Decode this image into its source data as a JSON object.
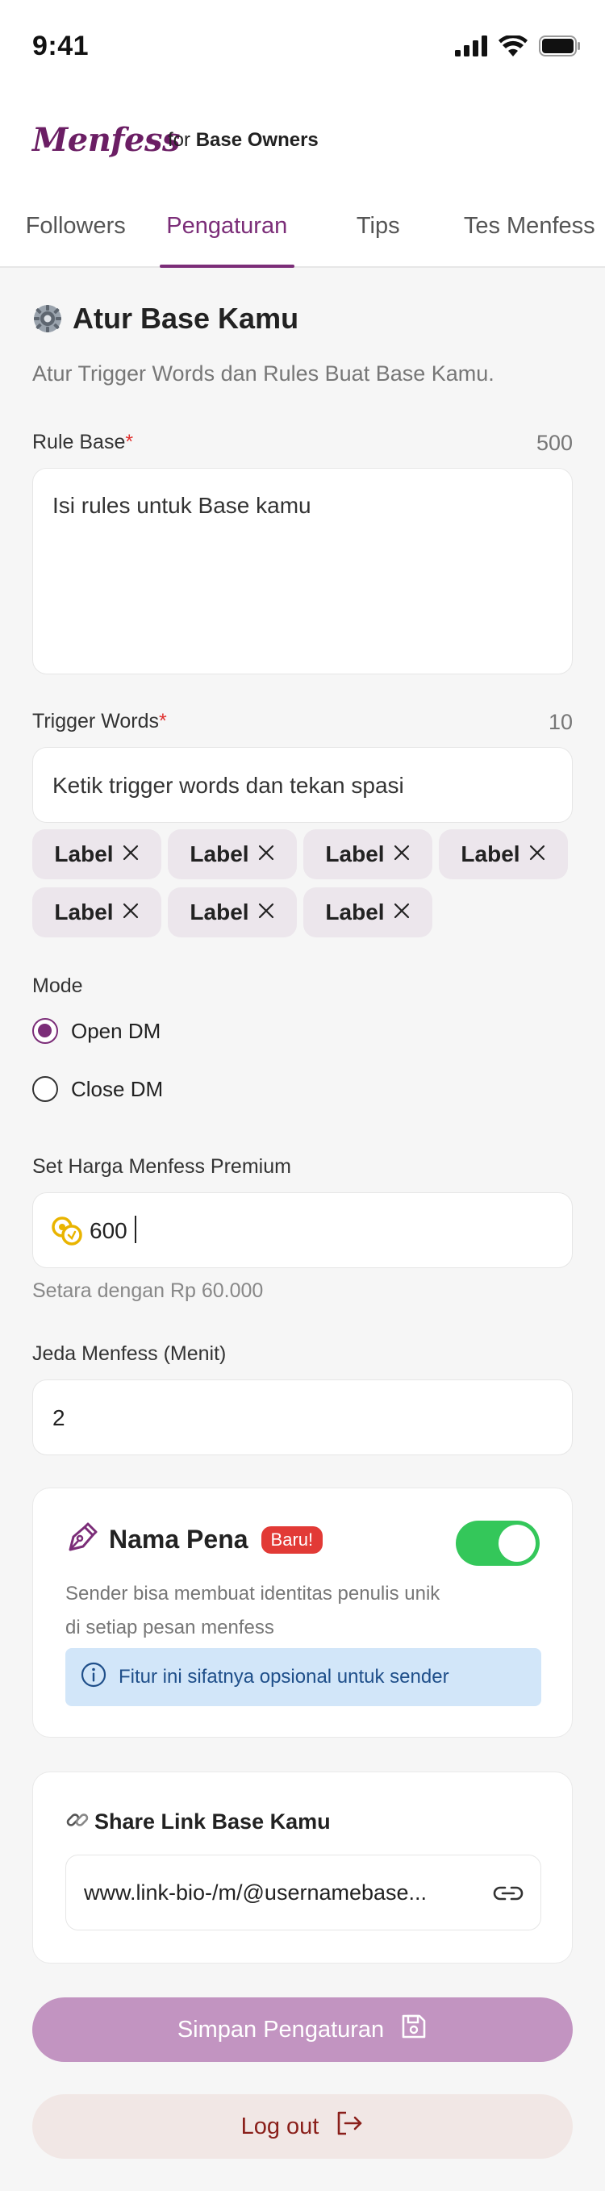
{
  "status_bar": {
    "time": "9:41"
  },
  "brand": {
    "logo": "Menfess",
    "for_prefix": "for",
    "for_audience": "Base Owners"
  },
  "tabs": [
    {
      "label": "Followers",
      "active": false
    },
    {
      "label": "Pengaturan",
      "active": true
    },
    {
      "label": "Tips",
      "active": false
    },
    {
      "label": "Tes Menfess",
      "active": false
    }
  ],
  "section": {
    "title": "Atur Base Kamu",
    "subtitle": "Atur Trigger Words dan Rules Buat Base Kamu."
  },
  "rule_base": {
    "label": "Rule Base",
    "required_mark": "*",
    "counter": "500",
    "placeholder": "Isi rules untuk Base kamu"
  },
  "trigger_words": {
    "label": "Trigger Words",
    "required_mark": "*",
    "counter": "10",
    "placeholder": "Ketik trigger words dan tekan spasi",
    "chips": [
      "Label",
      "Label",
      "Label",
      "Label",
      "Label",
      "Label",
      "Label"
    ]
  },
  "mode": {
    "label": "Mode",
    "options": [
      {
        "label": "Open DM",
        "selected": true
      },
      {
        "label": "Close DM",
        "selected": false
      }
    ]
  },
  "premium_price": {
    "label": "Set Harga Menfess Premium",
    "value": "600",
    "equivalent": "Setara dengan Rp 60.000"
  },
  "delay": {
    "label": "Jeda Menfess (Menit)",
    "value": "2"
  },
  "pen_name": {
    "title": "Nama Pena",
    "badge": "Baru!",
    "enabled": true,
    "description_line1": "Sender bisa membuat identitas penulis unik",
    "description_line2": "di setiap pesan menfess",
    "info": "Fitur ini sifatnya opsional untuk sender"
  },
  "share_link": {
    "title": "Share Link Base Kamu",
    "url": "www.link-bio-/m/@usernamebase..."
  },
  "buttons": {
    "save": "Simpan Pengaturan",
    "logout": "Log out"
  },
  "colors": {
    "brand": "#6b1e64",
    "accent": "#7b2d78",
    "save_button": "#c294c1",
    "toggle_on": "#34c75a",
    "required": "#e0312f",
    "info_bg": "#d2e6f9"
  },
  "icons": [
    "cellular-icon",
    "wifi-icon",
    "battery-icon",
    "gear-icon",
    "coin-icon",
    "pen-icon",
    "info-icon",
    "link-icon",
    "save-icon",
    "logout-icon"
  ]
}
